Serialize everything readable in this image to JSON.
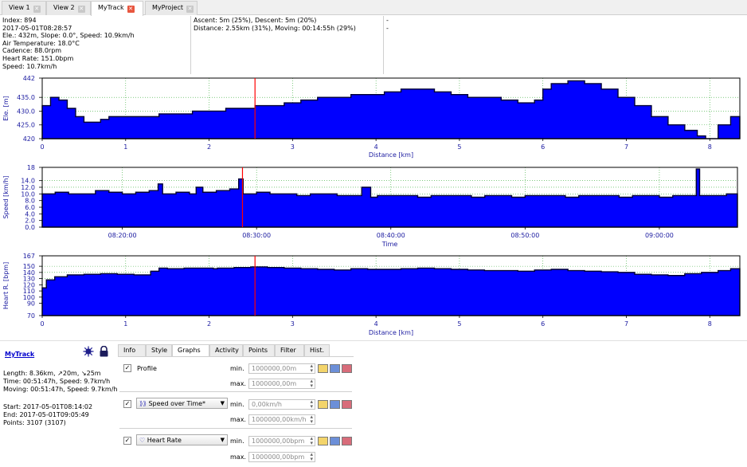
{
  "tabs": [
    {
      "label": "View 1",
      "active": false
    },
    {
      "label": "View 2",
      "active": false
    },
    {
      "label": "MyTrack",
      "active": true
    },
    {
      "label": "MyProject",
      "active": false
    }
  ],
  "info_col1": [
    "Index: 894",
    "2017-05-01T08:28:57",
    "Ele.: 432m, Slope: 0.0°, Speed: 10.9km/h",
    "Air Temperature: 18.0°C",
    "Cadence: 88.0rpm",
    "Heart Rate: 151.0bpm",
    "Speed: 10.7km/h"
  ],
  "info_col2": [
    "Ascent: 5m (25%), Descent: 5m (20%)",
    "Distance: 2.55km (31%), Moving: 00:14:55h (29%)"
  ],
  "info_col3": [
    "-",
    "-"
  ],
  "colors": {
    "fill": "#0000ff",
    "outline": "#000033",
    "cursor": "#ff0000",
    "axis_text": "#1a1aa0",
    "grid": "#33aa33"
  },
  "chart_data": [
    {
      "type": "area",
      "ylabel": "Ele. [m]",
      "xlabel": "Distance [km]",
      "ytick_labels": [
        "442",
        "435.0",
        "430.0",
        "425.0",
        "420"
      ],
      "xtick_labels": [
        "0",
        "1",
        "2",
        "3",
        "4",
        "5",
        "6",
        "7",
        "8"
      ],
      "xlim": [
        0,
        8.36
      ],
      "ylim": [
        420,
        442
      ],
      "cursor_x": 2.55,
      "x": [
        0,
        0.1,
        0.2,
        0.3,
        0.4,
        0.5,
        0.6,
        0.7,
        0.8,
        1.0,
        1.2,
        1.4,
        1.6,
        1.8,
        2.0,
        2.2,
        2.4,
        2.55,
        2.7,
        2.9,
        3.1,
        3.3,
        3.5,
        3.7,
        3.9,
        4.1,
        4.3,
        4.5,
        4.7,
        4.9,
        5.1,
        5.3,
        5.5,
        5.7,
        5.9,
        6.0,
        6.1,
        6.3,
        6.5,
        6.7,
        6.9,
        7.1,
        7.3,
        7.5,
        7.7,
        7.85,
        7.95,
        8.1,
        8.25,
        8.36
      ],
      "y": [
        432,
        435,
        434,
        431,
        428,
        426,
        426,
        427,
        428,
        428,
        428,
        429,
        429,
        430,
        430,
        431,
        431,
        432,
        432,
        433,
        434,
        435,
        435,
        436,
        436,
        437,
        438,
        438,
        437,
        436,
        435,
        435,
        434,
        433,
        434,
        438,
        440,
        441,
        440,
        438,
        435,
        432,
        428,
        425,
        423,
        421,
        420,
        425,
        428,
        428
      ]
    },
    {
      "type": "area",
      "ylabel": "Speed [km/h]",
      "xlabel": "Time",
      "ytick_labels": [
        "18",
        "14.0",
        "12.0",
        "10.0",
        "8.0",
        "6.0",
        "4.0",
        "2.0",
        "0.0"
      ],
      "xtick_labels": [
        "08:20:00",
        "08:30:00",
        "08:40:00",
        "08:50:00",
        "09:00:00"
      ],
      "xtick_values": [
        "08:20:00",
        "08:30:00",
        "08:40:00",
        "08:50:00",
        "09:00:00"
      ],
      "xlim": [
        "08:14:02",
        "09:05:49"
      ],
      "ylim": [
        0,
        18
      ],
      "cursor_x": "08:28:57",
      "x": [
        "08:14:02",
        "08:15:00",
        "08:16:00",
        "08:17:00",
        "08:18:00",
        "08:19:00",
        "08:20:00",
        "08:21:00",
        "08:22:00",
        "08:22:40",
        "08:23:00",
        "08:24:00",
        "08:25:00",
        "08:25:30",
        "08:26:00",
        "08:27:00",
        "08:28:00",
        "08:28:40",
        "08:29:00",
        "08:30:00",
        "08:31:00",
        "08:32:00",
        "08:33:00",
        "08:34:00",
        "08:35:00",
        "08:36:00",
        "08:37:00",
        "08:37:50",
        "08:38:30",
        "08:39:00",
        "08:40:00",
        "08:41:00",
        "08:42:00",
        "08:43:00",
        "08:44:00",
        "08:45:00",
        "08:46:00",
        "08:47:00",
        "08:48:00",
        "08:49:00",
        "08:50:00",
        "08:51:00",
        "08:52:00",
        "08:53:00",
        "08:54:00",
        "08:55:00",
        "08:56:00",
        "08:57:00",
        "08:58:00",
        "08:59:00",
        "09:00:00",
        "09:01:00",
        "09:02:00",
        "09:02:45",
        "09:03:00",
        "09:04:00",
        "09:05:00",
        "09:05:49"
      ],
      "y": [
        10,
        10.5,
        10,
        10,
        11,
        10.5,
        10,
        10.5,
        11,
        13,
        10,
        10.5,
        10,
        12,
        10.5,
        11,
        11.5,
        14.5,
        10,
        10.5,
        10,
        10,
        9.5,
        10,
        10,
        9.5,
        9.5,
        12,
        9,
        9.5,
        9.5,
        9.5,
        9,
        9.5,
        9.5,
        9.5,
        9,
        9.5,
        9.5,
        9,
        9.5,
        9.5,
        9.5,
        9,
        9.5,
        9.5,
        9.5,
        9,
        9.5,
        9.5,
        9,
        9.5,
        9.5,
        17.5,
        9.5,
        9.5,
        10,
        9
      ]
    },
    {
      "type": "area",
      "ylabel": "Heart R. [bpm]",
      "xlabel": "Distance [km]",
      "ytick_labels": [
        "167",
        "150",
        "140",
        "130",
        "120",
        "110",
        "100",
        "90",
        "70"
      ],
      "xtick_labels": [
        "0",
        "1",
        "2",
        "3",
        "4",
        "5",
        "6",
        "7",
        "8"
      ],
      "xlim": [
        0,
        8.36
      ],
      "ylim": [
        70,
        167
      ],
      "cursor_x": 2.55,
      "x": [
        0,
        0.05,
        0.15,
        0.3,
        0.5,
        0.7,
        0.9,
        1.1,
        1.3,
        1.4,
        1.5,
        1.7,
        1.9,
        2.05,
        2.1,
        2.3,
        2.5,
        2.7,
        2.9,
        3.1,
        3.3,
        3.5,
        3.7,
        3.9,
        4.1,
        4.3,
        4.5,
        4.7,
        4.9,
        5.1,
        5.3,
        5.5,
        5.7,
        5.9,
        6.1,
        6.3,
        6.5,
        6.7,
        6.9,
        7.1,
        7.3,
        7.5,
        7.7,
        7.9,
        8.1,
        8.25,
        8.36
      ],
      "y": [
        115,
        128,
        133,
        136,
        137,
        138,
        137,
        136,
        142,
        147,
        146,
        147,
        147,
        146,
        147,
        148,
        149,
        148,
        147,
        146,
        145,
        144,
        146,
        145,
        145,
        146,
        147,
        146,
        145,
        144,
        143,
        143,
        142,
        144,
        145,
        143,
        142,
        141,
        140,
        137,
        136,
        135,
        138,
        140,
        143,
        146,
        146
      ]
    }
  ],
  "track": {
    "name": "MyTrack",
    "stats": [
      "Length: 8.36km, ↗20m, ↘25m",
      "Time: 00:51:47h, Speed: 9.7km/h",
      "Moving: 00:51:47h, Speed: 9.7km/h"
    ],
    "times": [
      "Start: 2017-05-01T08:14:02",
      "End: 2017-05-01T09:05:49",
      "Points: 3107 (3107)"
    ]
  },
  "subtabs": [
    "Info",
    "Style",
    "Graphs",
    "Activity",
    "Points",
    "Filter",
    "Hist."
  ],
  "subtab_active": "Graphs",
  "graph_rows": [
    {
      "checked": true,
      "label": "Profile",
      "combo": false,
      "min_label": "min.",
      "min_value": "1000000,00m",
      "max_label": "max.",
      "max_value": "1000000,00m"
    },
    {
      "checked": true,
      "label": "Speed over Time*",
      "combo": true,
      "icon": "speed-icon",
      "min_label": "min.",
      "min_value": "0,00km/h",
      "max_label": "max.",
      "max_value": "1000000,00km/h"
    },
    {
      "checked": true,
      "label": "Heart Rate",
      "combo": true,
      "icon": "heart-icon",
      "min_label": "min.",
      "min_value": "1000000,00bpm",
      "max_label": "max.",
      "max_value": "1000000,00bpm"
    }
  ]
}
